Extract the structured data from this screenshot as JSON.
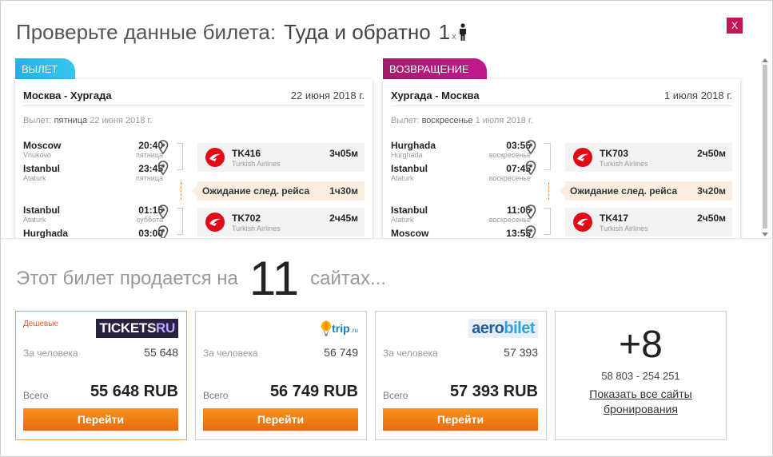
{
  "header": {
    "title": "Проверьте данные билета:",
    "trip_type": "Туда и обратно",
    "passenger_count": "1",
    "passenger_x": "x",
    "close_label": "X"
  },
  "legs": [
    {
      "tag": "ВЫЛЕТ",
      "route": "Москва - Хургада",
      "date": "22 июня 2018 г.",
      "dep_prefix": "Вылет:",
      "dep_day": "пятница",
      "dep_date": "22 июня 2018 г.",
      "stops": [
        {
          "city": "Moscow",
          "airport": "Vnukovo",
          "time": "20:40",
          "weekday": "пятница"
        },
        {
          "city": "Istanbul",
          "airport": "Ataturk",
          "time": "23:45",
          "weekday": "пятница"
        },
        {
          "city": "Istanbul",
          "airport": "Ataturk",
          "time": "01:15",
          "weekday": "суббота"
        },
        {
          "city": "Hurghada",
          "airport": "",
          "time": "03:00",
          "weekday": ""
        }
      ],
      "flights": [
        {
          "number": "TK416",
          "airline": "Turkish Airlines",
          "duration": "3ч05м"
        },
        {
          "number": "TK702",
          "airline": "Turkish Airlines",
          "duration": "2ч45м"
        }
      ],
      "wait": {
        "label": "Ожидание след. рейса",
        "duration": "1ч30м"
      }
    },
    {
      "tag": "ВОЗВРАЩЕНИЕ",
      "route": "Хургада - Москва",
      "date": "1 июля 2018 г.",
      "dep_prefix": "Вылет:",
      "dep_day": "воскресенье",
      "dep_date": "1 июля 2018 г.",
      "stops": [
        {
          "city": "Hurghada",
          "airport": "Hurghada",
          "time": "03:55",
          "weekday": "воскресенье"
        },
        {
          "city": "Istanbul",
          "airport": "Ataturk",
          "time": "07:45",
          "weekday": "воскресенье"
        },
        {
          "city": "Istanbul",
          "airport": "Ataturk",
          "time": "11:05",
          "weekday": "воскресенье"
        },
        {
          "city": "Moscow",
          "airport": "",
          "time": "13:55",
          "weekday": ""
        }
      ],
      "flights": [
        {
          "number": "TK703",
          "airline": "Turkish Airlines",
          "duration": "2ч50м"
        },
        {
          "number": "TK417",
          "airline": "Turkish Airlines",
          "duration": "2ч50м"
        }
      ],
      "wait": {
        "label": "Ожидание след. рейса",
        "duration": "3ч20м"
      }
    }
  ],
  "sites": {
    "prefix": "Этот билет продается на",
    "count": "11",
    "suffix": "сайтах..."
  },
  "offers": [
    {
      "badge": "Дешевые",
      "logo_a": "TICKETS",
      "logo_b": "RU",
      "per_person_label": "За человека",
      "per_person": "55 648",
      "total_label": "Всего",
      "total": "55 648 RUB",
      "button": "Перейти"
    },
    {
      "badge": "",
      "logo_a": "trip",
      "logo_b": ".ru",
      "per_person_label": "За человека",
      "per_person": "56 749",
      "total_label": "Всего",
      "total": "56 749 RUB",
      "button": "Перейти"
    },
    {
      "badge": "",
      "logo_a": "aero",
      "logo_b": "bilet",
      "per_person_label": "За человека",
      "per_person": "57 393",
      "total_label": "Всего",
      "total": "57 393 RUB",
      "button": "Перейти"
    }
  ],
  "more": {
    "count": "+8",
    "range": "58 803 - 254 251",
    "link": "Показать все сайты бронирования"
  },
  "colors": {
    "depart_tag": "#1fb4e6",
    "return_tag": "#c2188e",
    "close": "#c2185b",
    "button": "#f7931e",
    "wait_bg": "#fbeee1",
    "turkish_red": "#e30a17"
  },
  "icons": {
    "person": "person-icon",
    "pin": "map-pin-icon",
    "airline": "turkish-airlines-logo"
  }
}
